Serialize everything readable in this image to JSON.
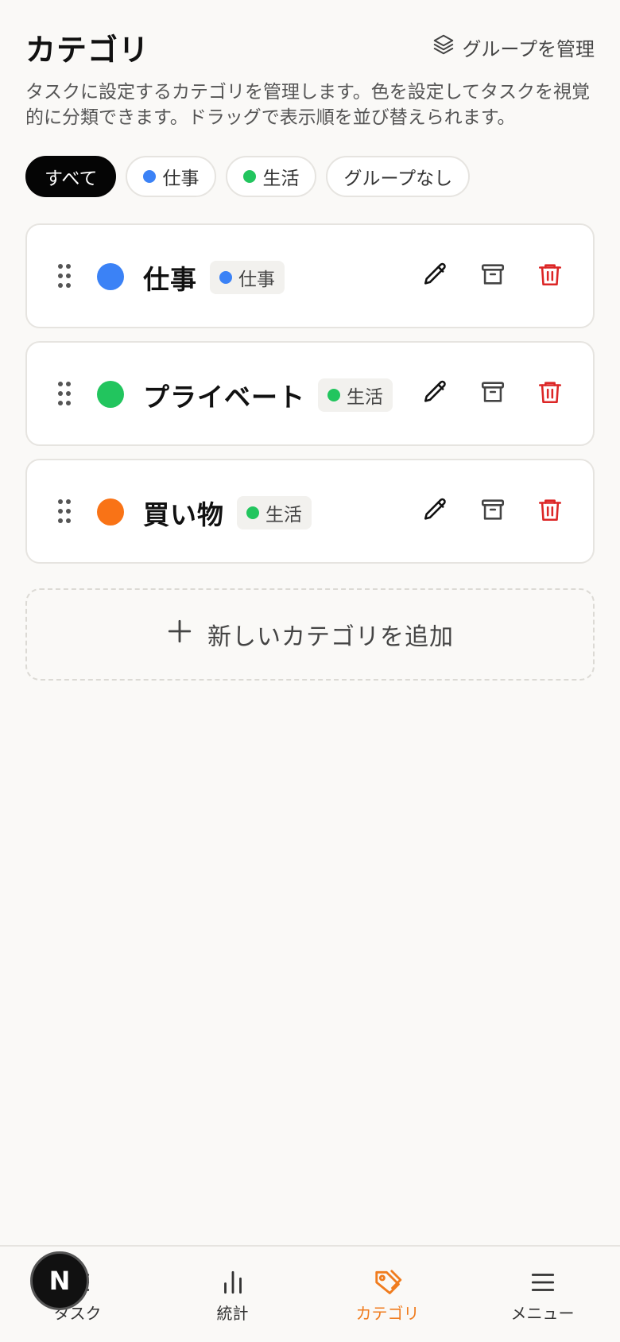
{
  "header": {
    "title": "カテゴリ",
    "manage_groups_label": "グループを管理"
  },
  "description": "タスクに設定するカテゴリを管理します。色を設定してタスクを視覚的に分類できます。ドラッグで表示順を並び替えられます。",
  "filters": [
    {
      "label": "すべて",
      "active": true
    },
    {
      "label": "仕事",
      "color": "#3b82f6"
    },
    {
      "label": "生活",
      "color": "#22c55e"
    },
    {
      "label": "グループなし"
    }
  ],
  "categories": [
    {
      "name": "仕事",
      "color": "#3b82f6",
      "group": "仕事",
      "group_color": "#3b82f6"
    },
    {
      "name": "プライベート",
      "color": "#22c55e",
      "group": "生活",
      "group_color": "#22c55e"
    },
    {
      "name": "買い物",
      "color": "#f97316",
      "group": "生活",
      "group_color": "#22c55e"
    }
  ],
  "add_category_label": "新しいカテゴリを追加",
  "bottom_nav": [
    {
      "label": "タスク",
      "icon": "list-icon"
    },
    {
      "label": "統計",
      "icon": "bar-chart-icon"
    },
    {
      "label": "カテゴリ",
      "icon": "tag-icon",
      "active": true
    },
    {
      "label": "メニュー",
      "icon": "menu-icon"
    }
  ],
  "floating_badge": "N",
  "colors": {
    "accent": "#f07c1e",
    "delete": "#dc2626"
  }
}
